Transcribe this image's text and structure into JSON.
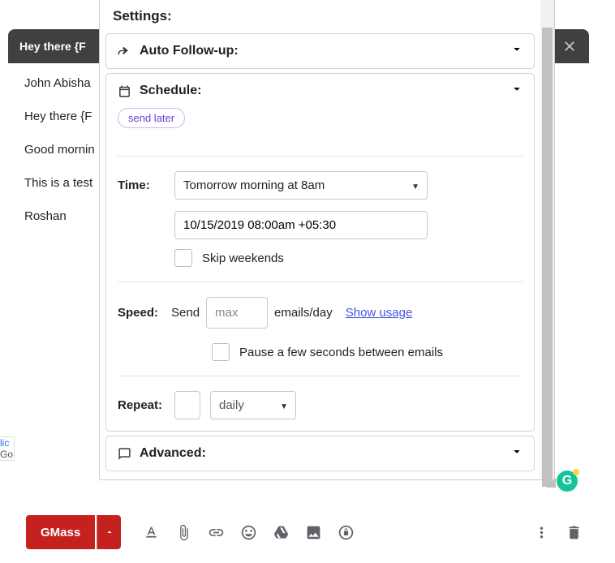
{
  "compose": {
    "subject": "Hey there {F",
    "close_icon": "close",
    "body": {
      "recipient": "John Abisha",
      "salutation_line": "Hey there {F",
      "greeting": "Good mornin",
      "content": "This is a test",
      "signature": "Roshan"
    }
  },
  "left_stub": {
    "line1": "lic",
    "line2": "Go"
  },
  "settings": {
    "title": "Settings:",
    "auto_followup": {
      "label": "Auto Follow-up:"
    },
    "schedule": {
      "label": "Schedule:",
      "send_later_label": "send later",
      "time_label": "Time:",
      "time_select_value": "Tomorrow morning at 8am",
      "datetime_value": "10/15/2019 08:00am +05:30",
      "skip_weekends_label": "Skip weekends",
      "speed_label": "Speed:",
      "send_text": "Send",
      "max_placeholder": "max",
      "emails_day_text": "emails/day",
      "show_usage_link": "Show usage",
      "pause_label": "Pause a few seconds between emails",
      "repeat_label": "Repeat:",
      "repeat_unit_value": "daily"
    },
    "advanced": {
      "label": "Advanced:"
    }
  },
  "toolbar": {
    "gmass_label": "GMass"
  },
  "grammarly_initial": "G"
}
